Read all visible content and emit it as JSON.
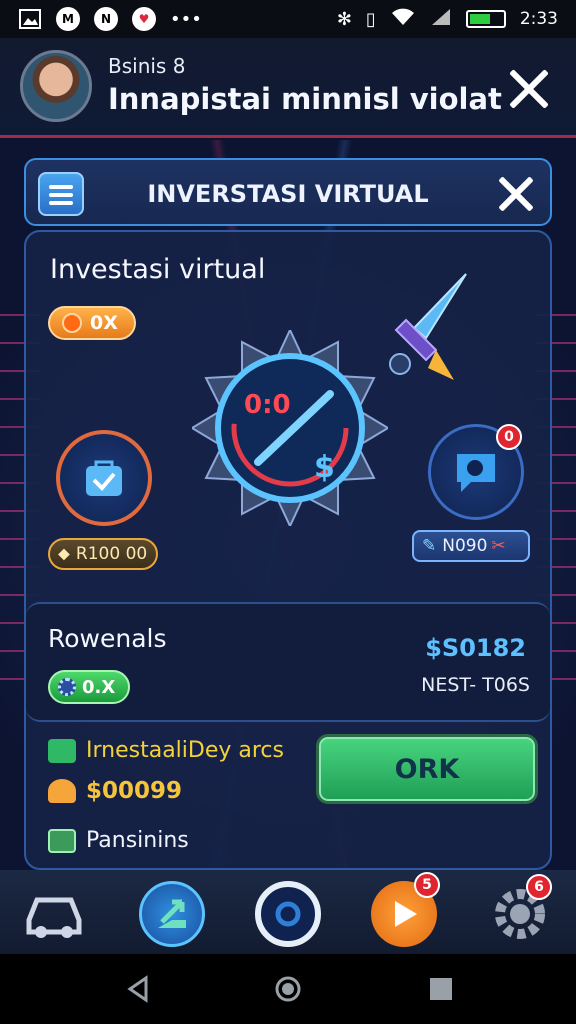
{
  "status_bar": {
    "time": "2:33"
  },
  "header": {
    "subtitle": "Bsinis 8",
    "title": "Innapistai minnisl violat"
  },
  "modal": {
    "title": "INVERSTASI VIRTUAL",
    "section_title": "Investasi virtual",
    "orange_pill": "0X",
    "gauge_text": "0:0",
    "gauge_symbol": "$",
    "left_badge": "R100 00",
    "right_badge_count": "0",
    "right_pill": "N090",
    "rewards": {
      "title": "Rowenals",
      "amount": "$S0182",
      "code": "NEST- T06S",
      "green_pill": "0.X"
    },
    "info": {
      "line1": "IrnestaaliDey arcs",
      "line2": "$00099",
      "line3": "Pansinins"
    },
    "primary_button": "ORK"
  },
  "bottom_nav": {
    "badges": {
      "play": "5",
      "settings": "6"
    }
  },
  "colors": {
    "accent_blue": "#3c8ee0",
    "ok_green": "#2fb865",
    "alert_red": "#e02430",
    "gold": "#f6c43a"
  }
}
